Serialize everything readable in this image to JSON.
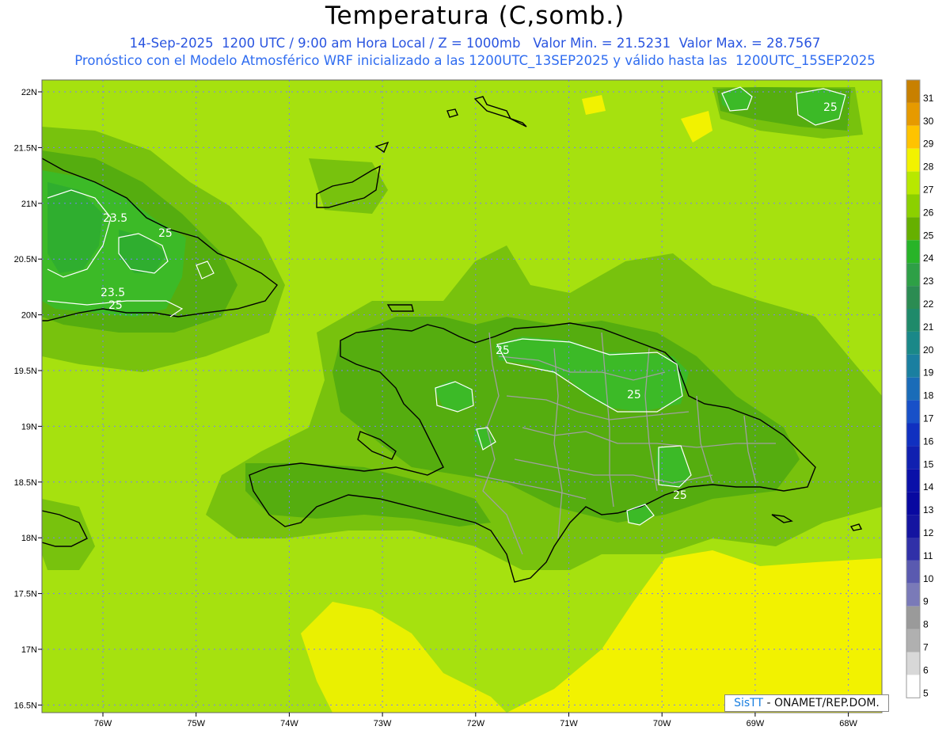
{
  "header": {
    "title": "Temperatura (C,somb.)",
    "subtitle1": "14-Sep-2025  1200 UTC / 9:00 am Hora Local / Z = 1000mb   Valor Min. = 21.5231  Valor Max. = 28.7567",
    "subtitle2": "Pronóstico con el Modelo Atmosférico WRF inicializado a las 1200UTC_13SEP2025 y válido hasta las  1200UTC_15SEP2025"
  },
  "map": {
    "lat_labels": [
      "22N",
      "21.5N",
      "21N",
      "20.5N",
      "20N",
      "19.5N",
      "19N",
      "18.5N",
      "18N",
      "17.5N",
      "17N",
      "16.5N"
    ],
    "lon_labels": [
      "76W",
      "75W",
      "74W",
      "73W",
      "72W",
      "71W",
      "70W",
      "69W",
      "68W"
    ],
    "contour_labels": [
      "23.5",
      "25",
      "23.5",
      "25",
      "25",
      "25",
      "25",
      "25"
    ],
    "colors": {
      "c23": "#2fae2f",
      "c24": "#3cba27",
      "c25": "#55ad0f",
      "c26": "#78c20d",
      "c27": "#a6e10f",
      "c28": "#f2f200",
      "coast": "#000000",
      "border": "#a0a0a0",
      "grid": "#7a7aff"
    }
  },
  "colorbar": {
    "labels": [
      "31",
      "30",
      "29",
      "28",
      "27",
      "26",
      "25",
      "24",
      "23",
      "22",
      "21",
      "20",
      "19",
      "18",
      "17",
      "16",
      "15",
      "14",
      "13",
      "12",
      "11",
      "10",
      "9",
      "8",
      "7",
      "6",
      "5"
    ],
    "colors": [
      "#c88000",
      "#e69a00",
      "#ffc300",
      "#f2f200",
      "#b8e800",
      "#8cd000",
      "#66b000",
      "#28b428",
      "#2ea046",
      "#2b8c52",
      "#1f8a6a",
      "#1a8888",
      "#1a7fa0",
      "#1a6cb8",
      "#1850c8",
      "#1030c0",
      "#1020b0",
      "#0a10a8",
      "#0808a0",
      "#1414a0",
      "#3030a8",
      "#5a5ab0",
      "#7a7ab8",
      "#9a9a9a",
      "#b0b0b0",
      "#d8d8d8",
      "#ffffff"
    ]
  },
  "footer": {
    "credit_brand": "SisTT",
    "credit_text": "- ONAMET/REP.DOM."
  }
}
